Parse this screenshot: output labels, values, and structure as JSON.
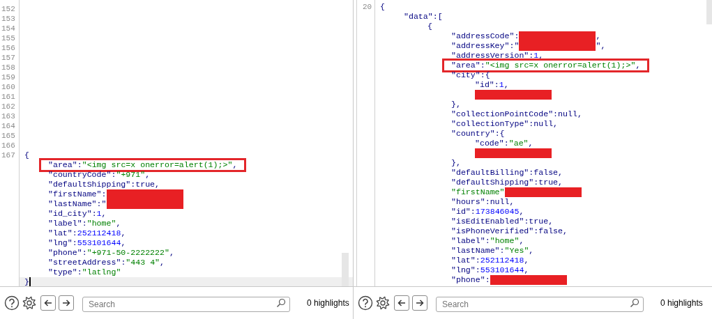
{
  "panes": [
    {
      "gutter": [
        "152",
        "153",
        "154",
        "155",
        "156",
        "157",
        "158",
        "159",
        "160",
        "161",
        "162",
        "163",
        "164",
        "165",
        "166",
        "167"
      ],
      "code": [
        {
          "text": "{",
          "children": [
            {
              "text": "\"area\":\"<img src=x onerror=alert(1);>\",",
              "annotated": true
            },
            {
              "text": "\"countryCode\":\"+971\","
            },
            {
              "text": "\"defaultShipping\":true,"
            },
            {
              "text": "\"firstName\":",
              "redacted": true
            },
            {
              "text": "\"lastName\":\"",
              "redacted": true
            },
            {
              "text": "\"id_city\":1,"
            },
            {
              "text": "\"label\":\"home\","
            },
            {
              "text": "\"lat\":252112418,"
            },
            {
              "text": "\"lng\":553101644,"
            },
            {
              "text": "\"phone\":\"+971-50-2222222\","
            },
            {
              "text": "\"streetAddress\":\"443 4\","
            },
            {
              "text": "\"type\":\"latlng\""
            }
          ]
        },
        {
          "text": "}",
          "current": true
        }
      ],
      "toolbar": {
        "search": {
          "placeholder": "Search"
        },
        "highlights": "0 highlights"
      }
    },
    {
      "gutter": [
        "20"
      ],
      "code": [
        {
          "text": "{",
          "children": [
            {
              "text": "\"data\":[",
              "children": [
                {
                  "text": "{",
                  "children": [
                    {
                      "text": "\"addressCode\":",
                      "redacted": true,
                      "after": ","
                    },
                    {
                      "text": "\"addressKey\":\"",
                      "redacted": true,
                      "after": "\","
                    },
                    {
                      "text": "\"addressVersion\":1,"
                    },
                    {
                      "text": "\"area\":\"<img src=x onerror=alert(1);>\",",
                      "annotated": true
                    },
                    {
                      "text": "\"city\":{",
                      "children": [
                        {
                          "text": "\"id\":1,"
                        },
                        {
                          "redacted": true
                        }
                      ]
                    },
                    {
                      "text": "},"
                    },
                    {
                      "text": "\"collectionPointCode\":null,"
                    },
                    {
                      "text": "\"collectionType\":null,"
                    },
                    {
                      "text": "\"country\":{",
                      "children": [
                        {
                          "text": "\"code\":\"ae\","
                        },
                        {
                          "redacted": true
                        }
                      ]
                    },
                    {
                      "text": "},"
                    },
                    {
                      "text": "\"defaultBilling\":false,"
                    },
                    {
                      "text": "\"defaultShipping\":true,"
                    },
                    {
                      "text": "\"firstName\"",
                      "redacted": true
                    },
                    {
                      "text": "\"hours\":null,"
                    },
                    {
                      "text": "\"id\":173846045,"
                    },
                    {
                      "text": "\"isEditEnabled\":true,"
                    },
                    {
                      "text": "\"isPhoneVerified\":false,"
                    },
                    {
                      "text": "\"label\":\"home\","
                    },
                    {
                      "text": "\"lastName\":\"Yes\","
                    },
                    {
                      "text": "\"lat\":252112418,"
                    },
                    {
                      "text": "\"lng\":553101644,"
                    },
                    {
                      "text": "\"phone\":",
                      "redacted": true
                    }
                  ]
                }
              ]
            }
          ]
        }
      ],
      "toolbar": {
        "search": {
          "placeholder": "Search"
        },
        "highlights": "0 highlights"
      }
    }
  ]
}
